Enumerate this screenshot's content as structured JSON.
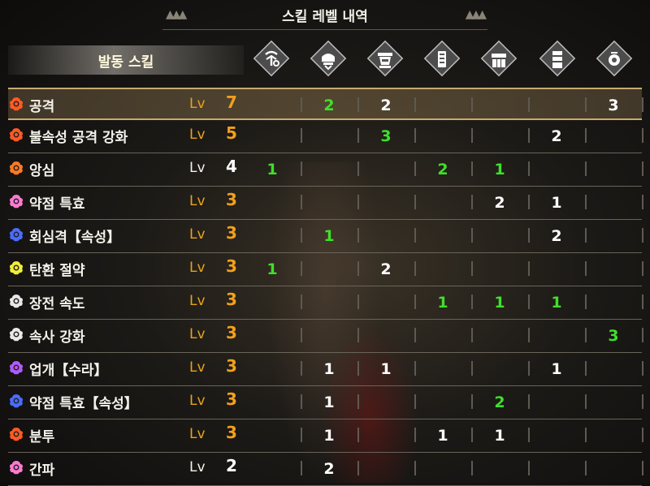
{
  "title": "스킬 레벨 내역",
  "header_label": "발동 스킬",
  "lv_label": "Lv",
  "columns": [
    {
      "icon": "weapon-icon"
    },
    {
      "icon": "helm-icon"
    },
    {
      "icon": "chest-armor-icon"
    },
    {
      "icon": "arm-armor-icon"
    },
    {
      "icon": "waist-armor-icon"
    },
    {
      "icon": "leg-armor-icon"
    },
    {
      "icon": "talisman-icon"
    }
  ],
  "colors": {
    "accent_gold": "#f2a01c",
    "green_value": "#3fe02a",
    "selected_border": "#c9aa6e"
  },
  "skills": [
    {
      "name": "공격",
      "icon": "orange-skill-icon",
      "color": "#ff5a22",
      "level": "7",
      "maxed": true,
      "selected": true,
      "cells": [
        {
          "v": ""
        },
        {
          "v": "2",
          "g": true
        },
        {
          "v": "2"
        },
        {
          "v": ""
        },
        {
          "v": ""
        },
        {
          "v": ""
        },
        {
          "v": "3"
        }
      ]
    },
    {
      "name": "불속성 공격 강화",
      "icon": "orange-skill-icon",
      "color": "#ff5a22",
      "level": "5",
      "maxed": true,
      "cells": [
        {
          "v": ""
        },
        {
          "v": ""
        },
        {
          "v": "3",
          "g": true
        },
        {
          "v": ""
        },
        {
          "v": ""
        },
        {
          "v": "2"
        },
        {
          "v": ""
        }
      ]
    },
    {
      "name": "앙심",
      "icon": "orange-skill-icon",
      "color": "#ff7a22",
      "level": "4",
      "maxed": false,
      "cells": [
        {
          "v": "1",
          "g": true
        },
        {
          "v": ""
        },
        {
          "v": ""
        },
        {
          "v": "2",
          "g": true
        },
        {
          "v": "1",
          "g": true
        },
        {
          "v": ""
        },
        {
          "v": ""
        }
      ]
    },
    {
      "name": "약점 특효",
      "icon": "pink-skill-icon",
      "color": "#ff7ad2",
      "level": "3",
      "maxed": true,
      "cells": [
        {
          "v": ""
        },
        {
          "v": ""
        },
        {
          "v": ""
        },
        {
          "v": ""
        },
        {
          "v": "2"
        },
        {
          "v": "1"
        },
        {
          "v": ""
        }
      ]
    },
    {
      "name": "회심격【속성】",
      "icon": "blue-skill-icon",
      "color": "#4a6cff",
      "level": "3",
      "maxed": true,
      "cells": [
        {
          "v": ""
        },
        {
          "v": "1",
          "g": true
        },
        {
          "v": ""
        },
        {
          "v": ""
        },
        {
          "v": ""
        },
        {
          "v": "2"
        },
        {
          "v": ""
        }
      ]
    },
    {
      "name": "탄환 절약",
      "icon": "yellow-skill-icon",
      "color": "#f2ec3a",
      "level": "3",
      "maxed": true,
      "cells": [
        {
          "v": "1",
          "g": true
        },
        {
          "v": ""
        },
        {
          "v": "2"
        },
        {
          "v": ""
        },
        {
          "v": ""
        },
        {
          "v": ""
        },
        {
          "v": ""
        }
      ]
    },
    {
      "name": "장전 속도",
      "icon": "white-skill-icon",
      "color": "#e8e8e8",
      "level": "3",
      "maxed": true,
      "cells": [
        {
          "v": ""
        },
        {
          "v": ""
        },
        {
          "v": ""
        },
        {
          "v": "1",
          "g": true
        },
        {
          "v": "1",
          "g": true
        },
        {
          "v": "1",
          "g": true
        },
        {
          "v": ""
        }
      ]
    },
    {
      "name": "속사 강화",
      "icon": "white-skill-icon",
      "color": "#e8e8e8",
      "level": "3",
      "maxed": true,
      "cells": [
        {
          "v": ""
        },
        {
          "v": ""
        },
        {
          "v": ""
        },
        {
          "v": ""
        },
        {
          "v": ""
        },
        {
          "v": ""
        },
        {
          "v": "3",
          "g": true
        }
      ]
    },
    {
      "name": "업개【수라】",
      "icon": "purple-skill-icon",
      "color": "#b25aff",
      "level": "3",
      "maxed": true,
      "cells": [
        {
          "v": ""
        },
        {
          "v": "1"
        },
        {
          "v": "1"
        },
        {
          "v": ""
        },
        {
          "v": ""
        },
        {
          "v": "1"
        },
        {
          "v": ""
        }
      ]
    },
    {
      "name": "약점 특효【속성】",
      "icon": "blue-skill-icon",
      "color": "#4a6cff",
      "level": "3",
      "maxed": true,
      "cells": [
        {
          "v": ""
        },
        {
          "v": "1"
        },
        {
          "v": ""
        },
        {
          "v": ""
        },
        {
          "v": "2",
          "g": true
        },
        {
          "v": ""
        },
        {
          "v": ""
        }
      ]
    },
    {
      "name": "분투",
      "icon": "orange-skill-icon",
      "color": "#ff5a22",
      "level": "3",
      "maxed": true,
      "cells": [
        {
          "v": ""
        },
        {
          "v": "1"
        },
        {
          "v": ""
        },
        {
          "v": "1"
        },
        {
          "v": "1"
        },
        {
          "v": ""
        },
        {
          "v": ""
        }
      ]
    },
    {
      "name": "간파",
      "icon": "pink-skill-icon",
      "color": "#ff7ad2",
      "level": "2",
      "maxed": false,
      "cells": [
        {
          "v": ""
        },
        {
          "v": "2"
        },
        {
          "v": ""
        },
        {
          "v": ""
        },
        {
          "v": ""
        },
        {
          "v": ""
        },
        {
          "v": ""
        }
      ]
    }
  ]
}
